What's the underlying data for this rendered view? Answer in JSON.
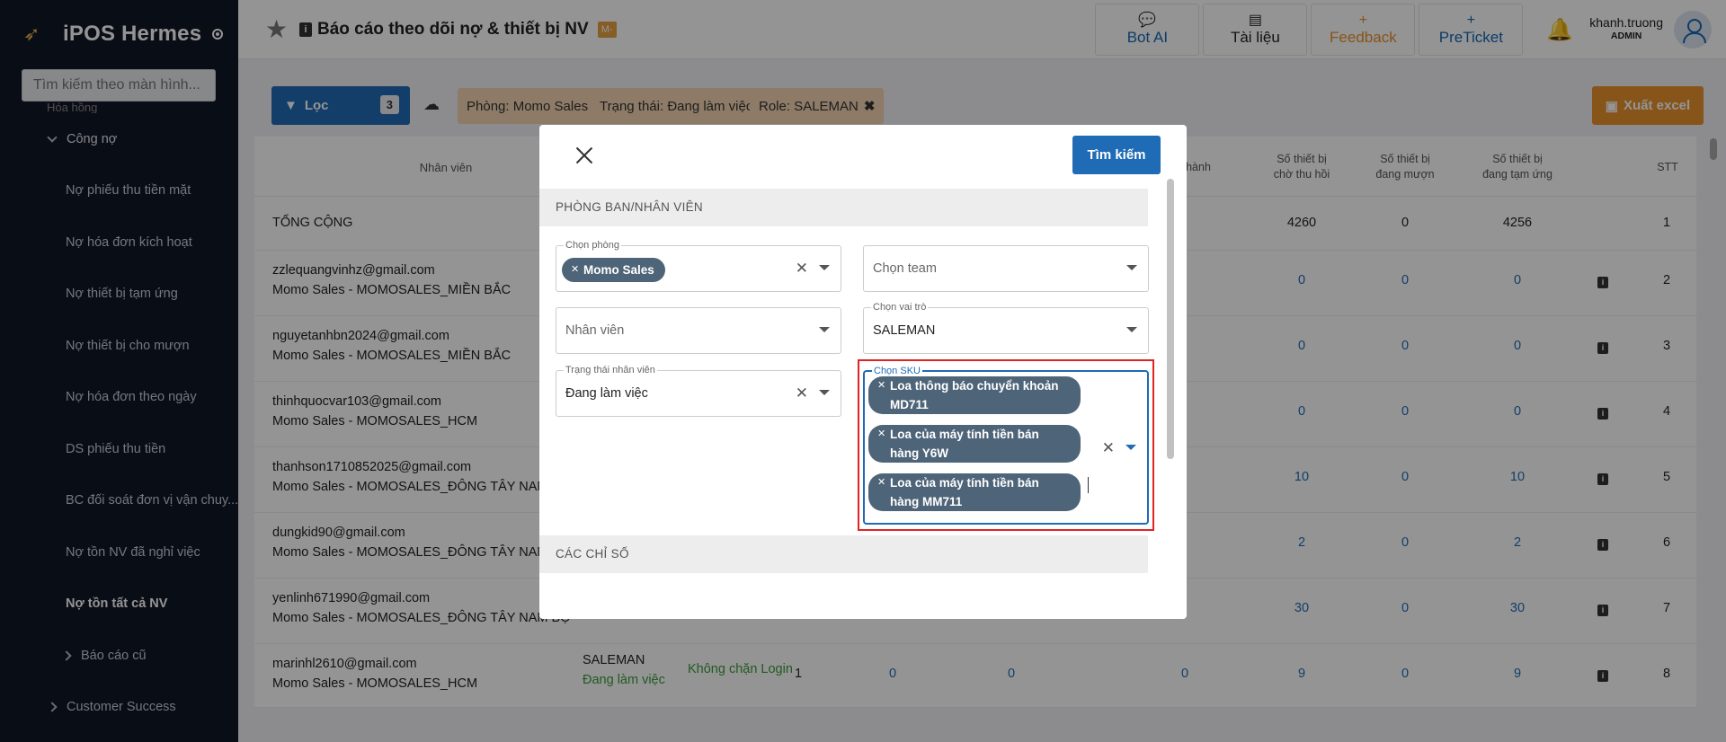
{
  "sidebar": {
    "app_name": "iPOS Hermes",
    "search_placeholder": "Tìm kiếm theo màn hình...",
    "partial_top": "Hóa hồng",
    "group_label": "Công nợ",
    "items": [
      "Nợ phiếu thu tiền mặt",
      "Nợ hóa đơn kích hoạt",
      "Nợ thiết bị tạm ứng",
      "Nợ thiết bị cho mượn",
      "Nợ hóa đơn theo ngày",
      "DS phiếu thu tiền",
      "BC đối soát đơn vị vận chuy...",
      "Nợ tồn NV đã nghỉ việc",
      "Nợ tồn tất cả NV"
    ],
    "old_reports": "Báo cáo cũ",
    "customer_success": "Customer Success"
  },
  "header": {
    "title": "Báo cáo theo dõi nợ & thiết bị NV",
    "badge": "M-",
    "buttons": {
      "bot_ai": "Bot AI",
      "docs": "Tài liệu",
      "feedback": "Feedback",
      "preticket": "PreTicket"
    },
    "user_name": "khanh.truong",
    "user_role": "ADMIN"
  },
  "toolbar": {
    "filter_label": "Lọc",
    "filter_count": "3",
    "chips": [
      "Phòng: Momo Sales",
      "Trạng thái: Đang làm việc",
      "Role: SALEMAN"
    ],
    "excel_label": "Xuất excel"
  },
  "table": {
    "headers": {
      "employee": "Nhân viên",
      "done_partial": "hành",
      "pending_recall_1": "Số thiết bị",
      "pending_recall_2": "chờ thu hồi",
      "borrowing_1": "Số thiết bị",
      "borrowing_2": "đang mượn",
      "advance_1": "Số thiết bị",
      "advance_2": "đang tạm ứng",
      "stt": "STT"
    },
    "total": {
      "label": "TỔNG CỘNG",
      "recall": "4260",
      "borrow": "0",
      "advance": "4256",
      "stt": "1"
    },
    "rows": [
      {
        "email": "zzlequangvinhz@gmail.com",
        "dept": "Momo Sales - MOMOSALES_MIỀN BẮC",
        "recall": "0",
        "borrow": "0",
        "advance": "0",
        "stt": "2"
      },
      {
        "email": "nguyetanhbn2024@gmail.com",
        "dept": "Momo Sales - MOMOSALES_MIỀN BẮC",
        "recall": "0",
        "borrow": "0",
        "advance": "0",
        "stt": "3"
      },
      {
        "email": "thinhquocvar103@gmail.com",
        "dept": "Momo Sales - MOMOSALES_HCM",
        "recall": "0",
        "borrow": "0",
        "advance": "0",
        "stt": "4"
      },
      {
        "email": "thanhson1710852025@gmail.com",
        "dept": "Momo Sales - MOMOSALES_ĐÔNG TÂY NAM B",
        "recall": "10",
        "borrow": "0",
        "advance": "10",
        "stt": "5"
      },
      {
        "email": "dungkid90@gmail.com",
        "dept": "Momo Sales - MOMOSALES_ĐÔNG TÂY NAM B",
        "recall": "2",
        "borrow": "0",
        "advance": "2",
        "stt": "6"
      },
      {
        "email": "yenlinh671990@gmail.com",
        "dept": "Momo Sales - MOMOSALES_ĐÔNG TÂY NAM BỘ",
        "recall": "30",
        "borrow": "0",
        "advance": "30",
        "stt": "7"
      },
      {
        "email": "marinhl2610@gmail.com",
        "dept": "Momo Sales - MOMOSALES_HCM",
        "recall": "9",
        "borrow": "0",
        "advance": "9",
        "stt": "8",
        "role": "SALEMAN",
        "status": "Đang làm việc",
        "login": "Không chặn Login",
        "c1": "1",
        "c2": "0",
        "c3": "0",
        "c4": "0"
      }
    ]
  },
  "modal": {
    "search_label": "Tìm kiếm",
    "section_dept": "PHÒNG BAN/NHÂN VIÊN",
    "section_metrics": "CÁC CHỈ SỐ",
    "dept_field": {
      "label": "Chọn phòng",
      "tag": "Momo Sales"
    },
    "team_field": {
      "placeholder": "Chọn team"
    },
    "role_field": {
      "label": "Chọn vai trò",
      "value": "SALEMAN"
    },
    "employee_field": {
      "placeholder": "Nhân viên"
    },
    "status_field": {
      "label": "Trạng thái nhân viên",
      "value": "Đang làm việc"
    },
    "sku_field": {
      "label": "Chọn SKU",
      "tags": [
        [
          "Loa thông báo chuyển khoản",
          "MD711"
        ],
        [
          "Loa của máy tính tiền bán",
          "hàng Y6W"
        ],
        [
          "Loa của máy tính tiền bán",
          "hàng MM711"
        ]
      ]
    }
  }
}
